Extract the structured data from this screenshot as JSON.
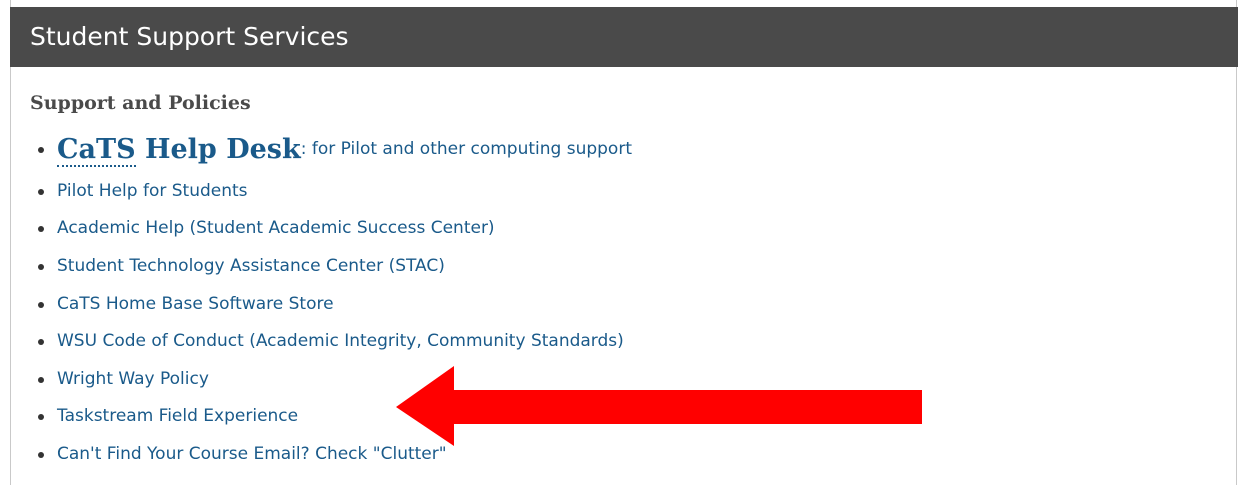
{
  "panel": {
    "title": "Student Support Services"
  },
  "section": {
    "heading": "Support and Policies"
  },
  "featured_link": {
    "abbr": "CaTS",
    "label": " Help Desk",
    "description": ": for Pilot and other computing support"
  },
  "links": [
    "Pilot Help for Students",
    "Academic Help (Student Academic Success Center)",
    "Student Technology Assistance Center (STAC)",
    "CaTS Home Base Software Store",
    "WSU Code of Conduct (Academic Integrity, Community Standards)",
    "Wright Way Policy",
    "Taskstream Field Experience",
    "Can't Find Your Course Email? Check \"Clutter\""
  ],
  "annotation": {
    "arrow_color": "#ff0000",
    "points_to": "Taskstream Field Experience"
  },
  "colors": {
    "header_bg": "#4a4a4a",
    "link": "#1a5a8a",
    "heading": "#4a4a4a"
  }
}
